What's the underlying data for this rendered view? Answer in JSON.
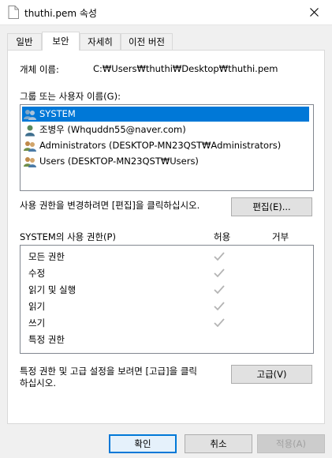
{
  "window": {
    "title": "thuthi.pem 속성",
    "close_icon": "close-icon"
  },
  "tabs": [
    {
      "label": "일반",
      "active": false
    },
    {
      "label": "보안",
      "active": true
    },
    {
      "label": "자세히",
      "active": false
    },
    {
      "label": "이전 버전",
      "active": false
    }
  ],
  "security": {
    "object_label": "개체 이름:",
    "object_value": "C:₩Users₩thuthi₩Desktop₩thuthi.pem",
    "groups_label": "그룹 또는 사용자 이름(G):",
    "groups": [
      {
        "name": "SYSTEM",
        "icon": "group-icon",
        "selected": true
      },
      {
        "name": "조병우 (Whquddn55@naver.com)",
        "icon": "user-icon",
        "selected": false
      },
      {
        "name": "Administrators (DESKTOP-MN23QST₩Administrators)",
        "icon": "group-icon",
        "selected": false
      },
      {
        "name": "Users (DESKTOP-MN23QST₩Users)",
        "icon": "group-icon",
        "selected": false
      }
    ],
    "edit_hint": "사용 권한을 변경하려면 [편집]을 클릭하십시오.",
    "edit_button": "편집(E)...",
    "permissions_label": "SYSTEM의 사용 권한(P)",
    "allow_header": "허용",
    "deny_header": "거부",
    "permissions": [
      {
        "name": "모든 권한",
        "allow": true,
        "deny": false
      },
      {
        "name": "수정",
        "allow": true,
        "deny": false
      },
      {
        "name": "읽기 및 실행",
        "allow": true,
        "deny": false
      },
      {
        "name": "읽기",
        "allow": true,
        "deny": false
      },
      {
        "name": "쓰기",
        "allow": true,
        "deny": false
      },
      {
        "name": "특정 권한",
        "allow": false,
        "deny": false
      }
    ],
    "advanced_hint_line1": "특정 권한 및 고급 설정을 보려면 [고급]을 클릭",
    "advanced_hint_line2": "하십시오.",
    "advanced_button": "고급(V)"
  },
  "footer": {
    "ok_label": "확인",
    "cancel_label": "취소",
    "apply_label": "적용(A)"
  },
  "colors": {
    "selection": "#0078d7",
    "check": "#b4b4b4",
    "primary_border": "#0078d7"
  }
}
